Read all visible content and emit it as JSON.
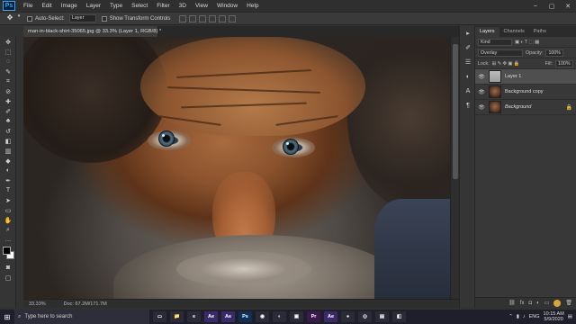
{
  "menubar": {
    "logo": "Ps",
    "items": [
      "File",
      "Edit",
      "Image",
      "Layer",
      "Type",
      "Select",
      "Filter",
      "3D",
      "View",
      "Window",
      "Help"
    ],
    "window_controls": [
      "–",
      "▢",
      "✕"
    ]
  },
  "options": {
    "auto_select_label": "Auto-Select:",
    "auto_select_target": "Layer",
    "transform_label": "Show Transform Controls"
  },
  "document": {
    "tab_title": "man-in-black-shirt-35065.jpg @ 33.3% (Layer 1, RGB/8) *",
    "zoom": "33.33%",
    "doc_info": "Doc: 67.2M/171.7M"
  },
  "layers_panel": {
    "tabs": [
      "Layers",
      "Channels",
      "Paths"
    ],
    "filter_label": "Kind",
    "blend_mode": "Overlay",
    "opacity_label": "Opacity:",
    "opacity_value": "100%",
    "lock_label": "Lock:",
    "fill_label": "Fill:",
    "fill_value": "100%",
    "layers": [
      {
        "name": "Layer 1",
        "active": true
      },
      {
        "name": "Background copy",
        "active": false
      },
      {
        "name": "Background",
        "active": false
      }
    ]
  },
  "taskbar": {
    "search_placeholder": "Type here to search",
    "apps": [
      {
        "label": "▭",
        "color": "#2b2b38"
      },
      {
        "label": "📁",
        "color": "#2b2b38"
      },
      {
        "label": "e",
        "color": "#2b2b38"
      },
      {
        "label": "Ae",
        "color": "#3a2a6a"
      },
      {
        "label": "Ae",
        "color": "#3a2a6a"
      },
      {
        "label": "Ps",
        "color": "#0f2f57"
      },
      {
        "label": "◉",
        "color": "#2b2b38"
      },
      {
        "label": "◐",
        "color": "#2b2b38"
      },
      {
        "label": "▣",
        "color": "#2b2b38"
      },
      {
        "label": "Pr",
        "color": "#3a1a4a"
      },
      {
        "label": "Ae",
        "color": "#3a2a6a"
      },
      {
        "label": "●",
        "color": "#2b2b38"
      },
      {
        "label": "◎",
        "color": "#2b2b38"
      },
      {
        "label": "▤",
        "color": "#2b2b38"
      },
      {
        "label": "◧",
        "color": "#2b2b38"
      }
    ],
    "lang": "ENG",
    "time": "10:15 AM",
    "date": "5/9/2020"
  }
}
